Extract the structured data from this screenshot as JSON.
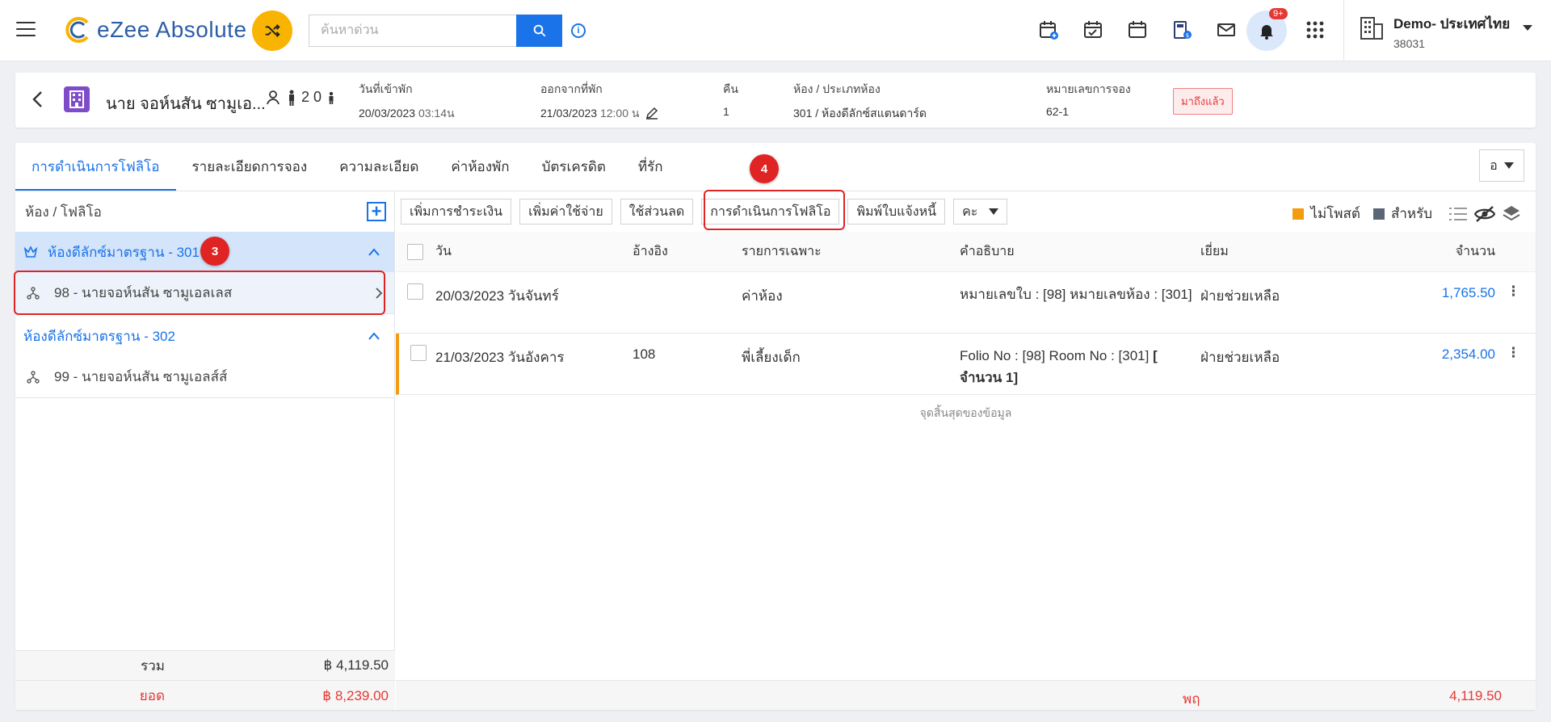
{
  "app": {
    "logo_text": "eZee Absolute",
    "search_placeholder": "ค้นหาด่วน",
    "notification_badge": "9+",
    "property_name": "Demo- ประเทศไทย",
    "property_id": "38031"
  },
  "reservation": {
    "guest_name": "นาย จอห์นสัน ซามูเอ...",
    "pax": "2 0",
    "checkin_label": "วันที่เข้าพัก",
    "checkin_date": "20/03/2023",
    "checkin_time": "03:14น",
    "checkout_label": "ออกจากที่พัก",
    "checkout_date": "21/03/2023",
    "checkout_time": "12:00 น",
    "nights_label": "คืน",
    "nights_value": "1",
    "room_label": "ห้อง / ประเภทห้อง",
    "room_value": "301 / ห้องดีลักซ์สแตนดาร์ด",
    "resno_label": "หมายเลขการจอง",
    "resno_value": "62-1",
    "status_badge": "มาถึงแล้ว"
  },
  "tabs": [
    {
      "label": "การดำเนินการโฟลิโอ"
    },
    {
      "label": "รายละเอียดการจอง"
    },
    {
      "label": "ความละเอียด"
    },
    {
      "label": "ค่าห้องพัก"
    },
    {
      "label": "บัตรเครดิต"
    },
    {
      "label": "ที่รัก"
    }
  ],
  "tab_dropdown": "อ",
  "left_panel": {
    "header": "ห้อง / โฟลิโอ",
    "groups": [
      {
        "label": "ห้องดีลักซ์มาตรฐาน - 301",
        "folio": "98 - นายจอห์นสัน ซามูเอลเลส"
      },
      {
        "label": "ห้องดีลักซ์มาตรฐาน - 302",
        "folio": "99 - นายจอห์นสัน ซามูเอลส์ส์"
      }
    ],
    "total_label": "รวม",
    "total_value": "฿ 4,119.50",
    "balance_label": "ยอด",
    "balance_value": "฿ 8,239.00"
  },
  "toolbar": {
    "add_payment": "เพิ่มการชำระเงิน",
    "add_charge": "เพิ่มค่าใช้จ่าย",
    "discount": "ใช้ส่วนลด",
    "folio_ops": "การดำเนินการโฟลิโอ",
    "print_invoice": "พิมพ์ใบแจ้งหนี้",
    "more": "คะ",
    "legend_unposted": "ไม่โพสต์",
    "legend_for": "สำหรับ"
  },
  "table": {
    "headers": {
      "date": "วัน",
      "ref": "อ้างอิง",
      "item": "รายการเฉพาะ",
      "desc": "คำอธิบาย",
      "visit": "เยี่ยม",
      "amount": "จำนวน"
    },
    "rows": [
      {
        "date": "20/03/2023 วันจันทร์",
        "ref": "",
        "item": "ค่าห้อง",
        "desc": "หมายเลขใบ : [98] หมายเลขห้อง : [301]",
        "desc_bold": "",
        "visit": "ฝ่ายช่วยเหลือ",
        "amount": "1,765.50"
      },
      {
        "date": "21/03/2023 วันอังคาร",
        "ref": "108",
        "item": "พี่เลี้ยงเด็ก",
        "desc": "Folio No : [98] Room No : [301] ",
        "desc_bold": "[ จำนวน 1]",
        "visit": "ฝ่ายช่วยเหลือ",
        "amount": "2,354.00"
      }
    ],
    "end_text": "จุดสิ้นสุดของข้อมูล",
    "footer_label": "พฤ",
    "footer_value": "4,119.50"
  },
  "annotations": {
    "marker_3": "3",
    "marker_4": "4"
  },
  "colors": {
    "accent": "#1a73e8",
    "unposted": "#f39c12",
    "for_legend": "#5a6678",
    "alert": "#e53935"
  }
}
